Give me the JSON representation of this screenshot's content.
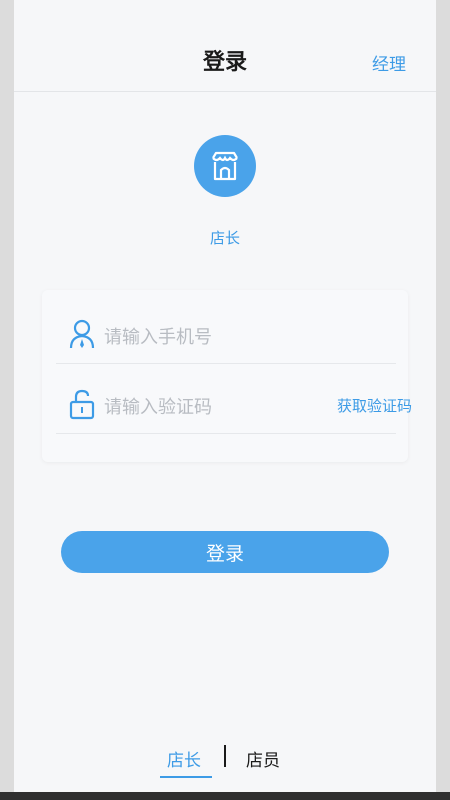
{
  "header": {
    "title": "登录",
    "manager_link": "经理"
  },
  "role": {
    "icon": "store-icon",
    "label": "店长"
  },
  "form": {
    "phone_placeholder": "请输入手机号",
    "code_placeholder": "请输入验证码",
    "get_code_label": "获取验证码"
  },
  "login_button": "登录",
  "bottom_tabs": {
    "active": "店长",
    "inactive": "店员"
  },
  "colors": {
    "accent": "#4aa3ea",
    "link": "#3d9be6",
    "background": "#f6f7f9"
  }
}
